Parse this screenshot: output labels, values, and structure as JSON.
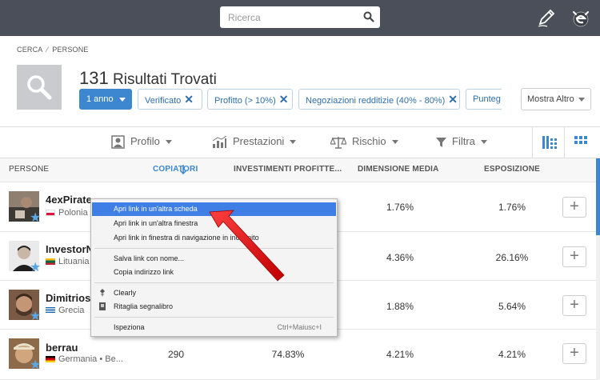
{
  "topbar": {
    "search_placeholder": "Ricerca",
    "icons": [
      "search-icon",
      "pencil-icon",
      "etoro-logo"
    ]
  },
  "breadcrumb": [
    "CERCA",
    "PERSONE"
  ],
  "results": {
    "count": "131",
    "label": "Risultati Trovati"
  },
  "filters": {
    "period": "1 anno",
    "chips": [
      "Verificato",
      "Profitto (> 10%)",
      "Negoziazioni redditizie (40% - 80%)",
      "Punteg"
    ],
    "more": "Mostra Altro"
  },
  "toolbar": {
    "profile": "Profilo",
    "performance": "Prestazioni",
    "risk": "Rischio",
    "filter": "Filtra"
  },
  "table": {
    "headers": [
      "PERSONE",
      "COPIATORI",
      "INVESTIMENTI PROFITTE...",
      "DIMENSIONE MEDIA",
      "ESPOSIZIONE"
    ],
    "rows": [
      {
        "name": "4exPirate",
        "country": "Polonia",
        "copiers": "",
        "profitable": "",
        "avg_size": "1.76%",
        "exposure": "1.76%"
      },
      {
        "name": "InvestorN",
        "country": "Lituania",
        "copiers": "",
        "profitable": "",
        "avg_size": "4.36%",
        "exposure": "26.16%"
      },
      {
        "name": "Dimitrios",
        "country": "Grecia",
        "copiers": "",
        "profitable": "",
        "avg_size": "1.88%",
        "exposure": "5.64%"
      },
      {
        "name": "berrau",
        "country": "Germania • Be...",
        "copiers": "290",
        "profitable": "74.83%",
        "avg_size": "4.21%",
        "exposure": "4.21%"
      }
    ]
  },
  "context_menu": {
    "items": [
      {
        "label": "Apri link in un'altra scheda",
        "highlighted": true
      },
      {
        "label": "Apri link in un'altra finestra"
      },
      {
        "label": "Apri link in finestra di navigazione in incognito"
      },
      {
        "label": "Salva link con nome..."
      },
      {
        "label": "Copia indirizzo link"
      },
      {
        "label": "Clearly",
        "icon": "clearly-icon"
      },
      {
        "label": "Ritaglia segnalibro",
        "icon": "bookmark-icon"
      },
      {
        "label": "Ispeziona",
        "shortcut": "Ctrl+Maiusc+I"
      }
    ]
  },
  "colors": {
    "topbar": "#4a4f59",
    "accent": "#3d87d0",
    "highlight": "#3f7fe5",
    "arrow": "#e01010"
  }
}
